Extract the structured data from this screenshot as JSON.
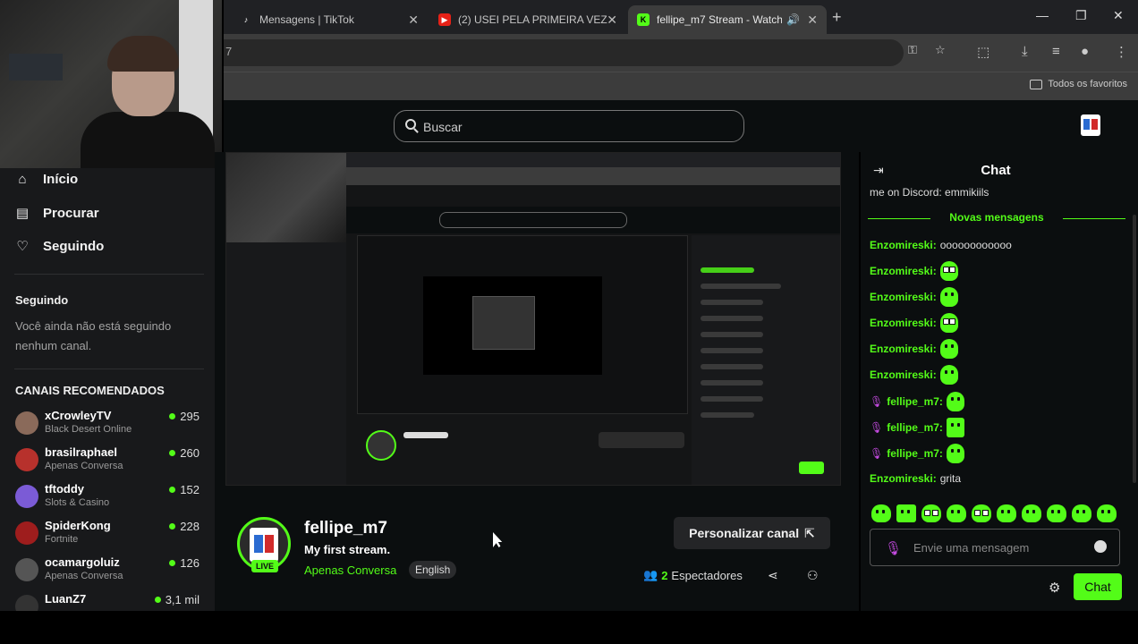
{
  "browser": {
    "tabs": [
      {
        "label": "Mensagens | TikTok",
        "favicon": "tiktok-icon"
      },
      {
        "label": "(2) USEI PELA PRIMEIRA VEZ M...",
        "favicon": "youtube-icon"
      },
      {
        "label": "fellipe_m7 Stream - Watch l...",
        "favicon": "kick-icon"
      }
    ],
    "bookmarks_label": "Todos os favoritos",
    "address_partial": "7"
  },
  "header": {
    "search_placeholder": "Buscar"
  },
  "sidebar": {
    "nav": [
      {
        "label": "Início",
        "icon": "home-icon"
      },
      {
        "label": "Procurar",
        "icon": "browse-icon"
      },
      {
        "label": "Seguindo",
        "icon": "heart-icon"
      }
    ],
    "following_title": "Seguindo",
    "following_note": "Você ainda não está seguindo nenhum canal.",
    "recommended_title": "CANAIS RECOMENDADOS",
    "channels": [
      {
        "name": "xCrowleyTV",
        "category": "Black Desert Online",
        "viewers": "295",
        "color": "#8a6a5a"
      },
      {
        "name": "brasilraphael",
        "category": "Apenas Conversa",
        "viewers": "260",
        "color": "#b7312c"
      },
      {
        "name": "tftoddy",
        "category": "Slots & Casino",
        "viewers": "152",
        "color": "#7b5bd6"
      },
      {
        "name": "SpiderKong",
        "category": "Fortnite",
        "viewers": "228",
        "color": "#9e1d1d"
      },
      {
        "name": "ocamargoluiz",
        "category": "Apenas Conversa",
        "viewers": "126",
        "color": "#555"
      },
      {
        "name": "LuanZ7",
        "category": "",
        "viewers": "3,1 mil",
        "color": "#333"
      }
    ]
  },
  "stream": {
    "streamer": "fellipe_m7",
    "title": "My first stream.",
    "category": "Apenas Conversa",
    "language": "English",
    "live_label": "LIVE",
    "personalize_label": "Personalizar canal",
    "viewer_count": "2",
    "viewer_label": "Espectadores"
  },
  "chat": {
    "title": "Chat",
    "previous_line": "me on Discord: emmikiils",
    "new_messages_label": "Novas mensagens",
    "messages": [
      {
        "user": "Enzomireski:",
        "color": "#53fc18",
        "text": "oooooooooooo",
        "emote": "",
        "mic": false
      },
      {
        "user": "Enzomireski:",
        "color": "#53fc18",
        "text": "",
        "emote": "eyes",
        "mic": false
      },
      {
        "user": "Enzomireski:",
        "color": "#53fc18",
        "text": "",
        "emote": "blob",
        "mic": false
      },
      {
        "user": "Enzomireski:",
        "color": "#53fc18",
        "text": "",
        "emote": "eyes",
        "mic": false
      },
      {
        "user": "Enzomireski:",
        "color": "#53fc18",
        "text": "",
        "emote": "blob",
        "mic": false
      },
      {
        "user": "Enzomireski:",
        "color": "#53fc18",
        "text": "",
        "emote": "blob",
        "mic": false
      },
      {
        "user": "fellipe_m7:",
        "color": "#53fc18",
        "text": "",
        "emote": "blob",
        "mic": true
      },
      {
        "user": "fellipe_m7:",
        "color": "#53fc18",
        "text": "",
        "emote": "sq",
        "mic": true
      },
      {
        "user": "fellipe_m7:",
        "color": "#53fc18",
        "text": "",
        "emote": "blob",
        "mic": true
      },
      {
        "user": "Enzomireski:",
        "color": "#53fc18",
        "text": "grita",
        "emote": "",
        "mic": false
      }
    ],
    "input_placeholder": "Envie uma mensagem",
    "send_label": "Chat"
  },
  "colors": {
    "accent": "#53fc18",
    "background": "#0b0e0f",
    "sidebar": "#18191b"
  }
}
